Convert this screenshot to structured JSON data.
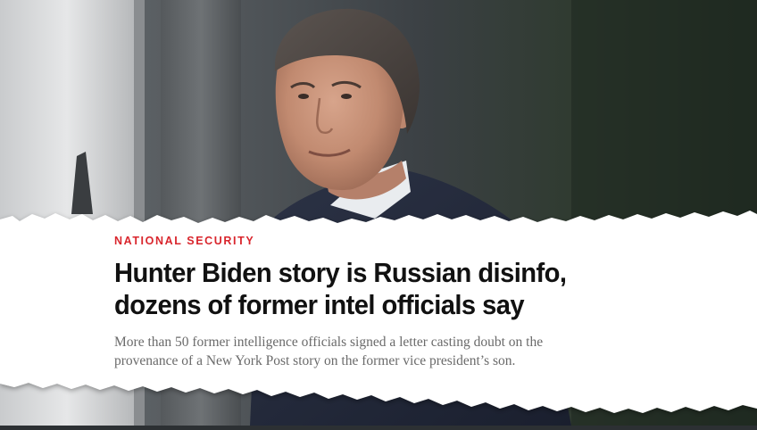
{
  "article_card": {
    "kicker": "NATIONAL SECURITY",
    "headline_line1": "Hunter Biden story is Russian disinfo,",
    "headline_line2": "dozens of former intel officials say",
    "dek_line1": "More than 50 former intelligence officials signed a letter casting doubt on the",
    "dek_line2": "provenance of a New York Post story on the former vice president’s son."
  },
  "colors": {
    "kicker": "#d9262d",
    "headline": "#111111",
    "dek": "#6a6a6a",
    "paper": "#ffffff"
  }
}
